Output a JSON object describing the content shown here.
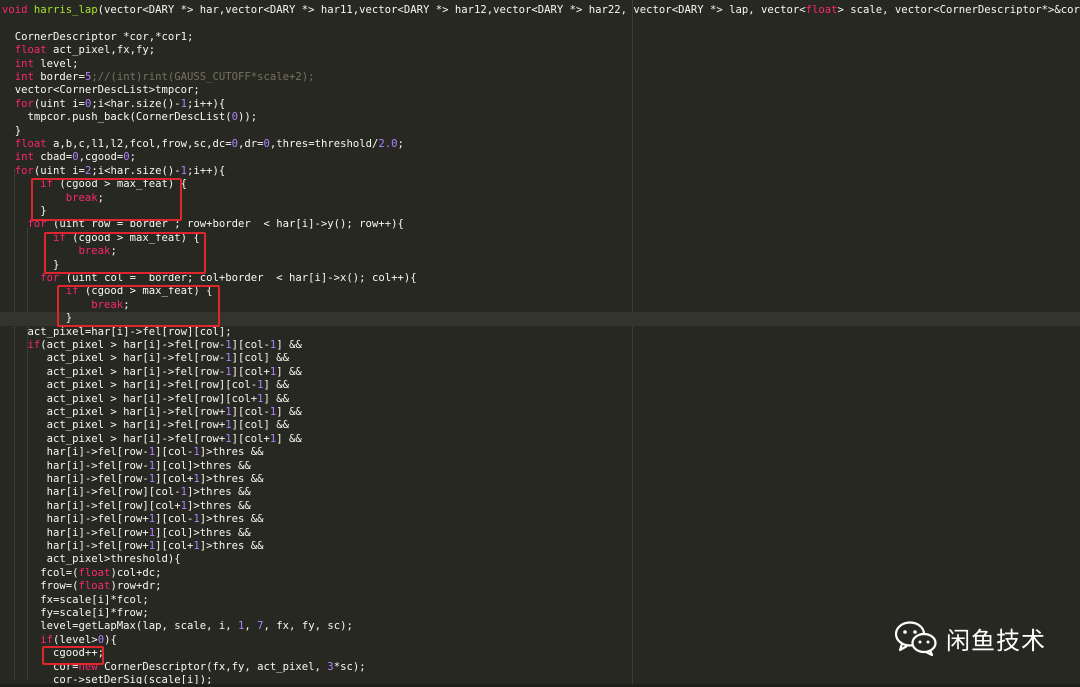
{
  "editor": {
    "lines": [
      [
        {
          "t": "void ",
          "c": "kw"
        },
        {
          "t": "harris_lap",
          "c": "fn"
        },
        {
          "t": "(vector<DARY *> har,vector<DARY *> har11,vector<DARY *> har12,vector<DARY *> har22, vector<DARY *> lap, vector<",
          "c": "pl"
        },
        {
          "t": "float",
          "c": "kw"
        },
        {
          "t": "> scale, vector<CornerDescriptor*>&corne",
          "c": "pl"
        }
      ],
      [],
      [
        {
          "t": "  CornerDescriptor *cor,*cor1;",
          "c": "pl"
        }
      ],
      [
        {
          "t": "  ",
          "c": "pl"
        },
        {
          "t": "float",
          "c": "kw"
        },
        {
          "t": " act_pixel,fx,fy;",
          "c": "pl"
        }
      ],
      [
        {
          "t": "  ",
          "c": "pl"
        },
        {
          "t": "int",
          "c": "kw"
        },
        {
          "t": " level;",
          "c": "pl"
        }
      ],
      [
        {
          "t": "  ",
          "c": "pl"
        },
        {
          "t": "int",
          "c": "kw"
        },
        {
          "t": " border=",
          "c": "pl"
        },
        {
          "t": "5",
          "c": "num"
        },
        {
          "t": ";//(int)rint(GAUSS_CUTOFF*scale+2);",
          "c": "cm"
        }
      ],
      [
        {
          "t": "  vector<CornerDescList>tmpcor;",
          "c": "pl"
        }
      ],
      [
        {
          "t": "  ",
          "c": "pl"
        },
        {
          "t": "for",
          "c": "kw"
        },
        {
          "t": "(uint i=",
          "c": "pl"
        },
        {
          "t": "0",
          "c": "num"
        },
        {
          "t": ";i<har.size()-",
          "c": "pl"
        },
        {
          "t": "1",
          "c": "num"
        },
        {
          "t": ";i++){",
          "c": "pl"
        }
      ],
      [
        {
          "t": "    tmpcor.push_back(CornerDescList(",
          "c": "pl"
        },
        {
          "t": "0",
          "c": "num"
        },
        {
          "t": "));",
          "c": "pl"
        }
      ],
      [
        {
          "t": "  }",
          "c": "pl"
        }
      ],
      [
        {
          "t": "  ",
          "c": "pl"
        },
        {
          "t": "float",
          "c": "kw"
        },
        {
          "t": " a,b,c,l1,l2,fcol,frow,sc,dc=",
          "c": "pl"
        },
        {
          "t": "0",
          "c": "num"
        },
        {
          "t": ",dr=",
          "c": "pl"
        },
        {
          "t": "0",
          "c": "num"
        },
        {
          "t": ",thres=threshold/",
          "c": "pl"
        },
        {
          "t": "2.0",
          "c": "num"
        },
        {
          "t": ";",
          "c": "pl"
        }
      ],
      [
        {
          "t": "  ",
          "c": "pl"
        },
        {
          "t": "int",
          "c": "kw"
        },
        {
          "t": " cbad=",
          "c": "pl"
        },
        {
          "t": "0",
          "c": "num"
        },
        {
          "t": ",cgood=",
          "c": "pl"
        },
        {
          "t": "0",
          "c": "num"
        },
        {
          "t": ";",
          "c": "pl"
        }
      ],
      [
        {
          "t": "  ",
          "c": "pl"
        },
        {
          "t": "for",
          "c": "kw"
        },
        {
          "t": "(uint i=",
          "c": "pl"
        },
        {
          "t": "2",
          "c": "num"
        },
        {
          "t": ";i<har.size()-",
          "c": "pl"
        },
        {
          "t": "1",
          "c": "num"
        },
        {
          "t": ";i++){",
          "c": "pl"
        }
      ],
      [
        {
          "t": "      ",
          "c": "pl"
        },
        {
          "t": "if",
          "c": "kw"
        },
        {
          "t": " (cgood > max_feat) {",
          "c": "pl"
        }
      ],
      [
        {
          "t": "          ",
          "c": "pl"
        },
        {
          "t": "break",
          "c": "kw"
        },
        {
          "t": ";",
          "c": "pl"
        }
      ],
      [
        {
          "t": "      }",
          "c": "pl"
        }
      ],
      [
        {
          "t": "    ",
          "c": "pl"
        },
        {
          "t": "for",
          "c": "kw"
        },
        {
          "t": " (uint row = border ; row+border  < har[i]->y(); row++){",
          "c": "pl"
        }
      ],
      [
        {
          "t": "        ",
          "c": "pl"
        },
        {
          "t": "if",
          "c": "kw"
        },
        {
          "t": " (cgood > max_feat) {",
          "c": "pl"
        }
      ],
      [
        {
          "t": "            ",
          "c": "pl"
        },
        {
          "t": "break",
          "c": "kw"
        },
        {
          "t": ";",
          "c": "pl"
        }
      ],
      [
        {
          "t": "        }",
          "c": "pl"
        }
      ],
      [
        {
          "t": "      ",
          "c": "pl"
        },
        {
          "t": "for",
          "c": "kw"
        },
        {
          "t": " (uint col =  border; col+border  < har[i]->x(); col++){",
          "c": "pl"
        }
      ],
      [
        {
          "t": "          ",
          "c": "pl"
        },
        {
          "t": "if",
          "c": "kw"
        },
        {
          "t": " (cgood > max_feat) {",
          "c": "pl"
        }
      ],
      [
        {
          "t": "              ",
          "c": "pl"
        },
        {
          "t": "break",
          "c": "kw"
        },
        {
          "t": ";",
          "c": "pl"
        }
      ],
      [
        {
          "t": "          }",
          "c": "pl"
        }
      ],
      [
        {
          "t": "    act_pixel=har[i]->fel[row][col];",
          "c": "pl"
        }
      ],
      [
        {
          "t": "    ",
          "c": "pl"
        },
        {
          "t": "if",
          "c": "kw"
        },
        {
          "t": "(act_pixel > har[i]->fel[row-",
          "c": "pl"
        },
        {
          "t": "1",
          "c": "num"
        },
        {
          "t": "][col-",
          "c": "pl"
        },
        {
          "t": "1",
          "c": "num"
        },
        {
          "t": "] &&",
          "c": "pl"
        }
      ],
      [
        {
          "t": "       act_pixel > har[i]->fel[row-",
          "c": "pl"
        },
        {
          "t": "1",
          "c": "num"
        },
        {
          "t": "][col] &&",
          "c": "pl"
        }
      ],
      [
        {
          "t": "       act_pixel > har[i]->fel[row-",
          "c": "pl"
        },
        {
          "t": "1",
          "c": "num"
        },
        {
          "t": "][col+",
          "c": "pl"
        },
        {
          "t": "1",
          "c": "num"
        },
        {
          "t": "] &&",
          "c": "pl"
        }
      ],
      [
        {
          "t": "       act_pixel > har[i]->fel[row][col-",
          "c": "pl"
        },
        {
          "t": "1",
          "c": "num"
        },
        {
          "t": "] &&",
          "c": "pl"
        }
      ],
      [
        {
          "t": "       act_pixel > har[i]->fel[row][col+",
          "c": "pl"
        },
        {
          "t": "1",
          "c": "num"
        },
        {
          "t": "] &&",
          "c": "pl"
        }
      ],
      [
        {
          "t": "       act_pixel > har[i]->fel[row+",
          "c": "pl"
        },
        {
          "t": "1",
          "c": "num"
        },
        {
          "t": "][col-",
          "c": "pl"
        },
        {
          "t": "1",
          "c": "num"
        },
        {
          "t": "] &&",
          "c": "pl"
        }
      ],
      [
        {
          "t": "       act_pixel > har[i]->fel[row+",
          "c": "pl"
        },
        {
          "t": "1",
          "c": "num"
        },
        {
          "t": "][col] &&",
          "c": "pl"
        }
      ],
      [
        {
          "t": "       act_pixel > har[i]->fel[row+",
          "c": "pl"
        },
        {
          "t": "1",
          "c": "num"
        },
        {
          "t": "][col+",
          "c": "pl"
        },
        {
          "t": "1",
          "c": "num"
        },
        {
          "t": "] &&",
          "c": "pl"
        }
      ],
      [
        {
          "t": "       har[i]->fel[row-",
          "c": "pl"
        },
        {
          "t": "1",
          "c": "num"
        },
        {
          "t": "][col-",
          "c": "pl"
        },
        {
          "t": "1",
          "c": "num"
        },
        {
          "t": "]>thres &&",
          "c": "pl"
        }
      ],
      [
        {
          "t": "       har[i]->fel[row-",
          "c": "pl"
        },
        {
          "t": "1",
          "c": "num"
        },
        {
          "t": "][col]>thres &&",
          "c": "pl"
        }
      ],
      [
        {
          "t": "       har[i]->fel[row-",
          "c": "pl"
        },
        {
          "t": "1",
          "c": "num"
        },
        {
          "t": "][col+",
          "c": "pl"
        },
        {
          "t": "1",
          "c": "num"
        },
        {
          "t": "]>thres &&",
          "c": "pl"
        }
      ],
      [
        {
          "t": "       har[i]->fel[row][col-",
          "c": "pl"
        },
        {
          "t": "1",
          "c": "num"
        },
        {
          "t": "]>thres &&",
          "c": "pl"
        }
      ],
      [
        {
          "t": "       har[i]->fel[row][col+",
          "c": "pl"
        },
        {
          "t": "1",
          "c": "num"
        },
        {
          "t": "]>thres &&",
          "c": "pl"
        }
      ],
      [
        {
          "t": "       har[i]->fel[row+",
          "c": "pl"
        },
        {
          "t": "1",
          "c": "num"
        },
        {
          "t": "][col-",
          "c": "pl"
        },
        {
          "t": "1",
          "c": "num"
        },
        {
          "t": "]>thres &&",
          "c": "pl"
        }
      ],
      [
        {
          "t": "       har[i]->fel[row+",
          "c": "pl"
        },
        {
          "t": "1",
          "c": "num"
        },
        {
          "t": "][col]>thres &&",
          "c": "pl"
        }
      ],
      [
        {
          "t": "       har[i]->fel[row+",
          "c": "pl"
        },
        {
          "t": "1",
          "c": "num"
        },
        {
          "t": "][col+",
          "c": "pl"
        },
        {
          "t": "1",
          "c": "num"
        },
        {
          "t": "]>thres &&",
          "c": "pl"
        }
      ],
      [
        {
          "t": "       act_pixel>threshold){",
          "c": "pl"
        }
      ],
      [
        {
          "t": "      fcol=(",
          "c": "pl"
        },
        {
          "t": "float",
          "c": "kw"
        },
        {
          "t": ")col+dc;",
          "c": "pl"
        }
      ],
      [
        {
          "t": "      frow=(",
          "c": "pl"
        },
        {
          "t": "float",
          "c": "kw"
        },
        {
          "t": ")row+dr;",
          "c": "pl"
        }
      ],
      [
        {
          "t": "      fx=scale[i]*fcol;",
          "c": "pl"
        }
      ],
      [
        {
          "t": "      fy=scale[i]*frow;",
          "c": "pl"
        }
      ],
      [
        {
          "t": "      level=getLapMax(lap, scale, i, ",
          "c": "pl"
        },
        {
          "t": "1",
          "c": "num"
        },
        {
          "t": ", ",
          "c": "pl"
        },
        {
          "t": "7",
          "c": "num"
        },
        {
          "t": ", fx, fy, sc);",
          "c": "pl"
        }
      ],
      [
        {
          "t": "      ",
          "c": "pl"
        },
        {
          "t": "if",
          "c": "kw"
        },
        {
          "t": "(level>",
          "c": "pl"
        },
        {
          "t": "0",
          "c": "num"
        },
        {
          "t": "){",
          "c": "pl"
        }
      ],
      [
        {
          "t": "        cgood++;",
          "c": "pl"
        }
      ],
      [
        {
          "t": "        cor=",
          "c": "pl"
        },
        {
          "t": "new",
          "c": "kw"
        },
        {
          "t": " CornerDescriptor(fx,fy, act_pixel, ",
          "c": "pl"
        },
        {
          "t": "3",
          "c": "num"
        },
        {
          "t": "*sc);",
          "c": "pl"
        }
      ],
      [
        {
          "t": "        cor->setDerSig(scale[i]);",
          "c": "pl"
        }
      ]
    ],
    "current_line": 23
  },
  "watermark": {
    "text": "闲鱼技术",
    "icon": "wechat-icon"
  }
}
